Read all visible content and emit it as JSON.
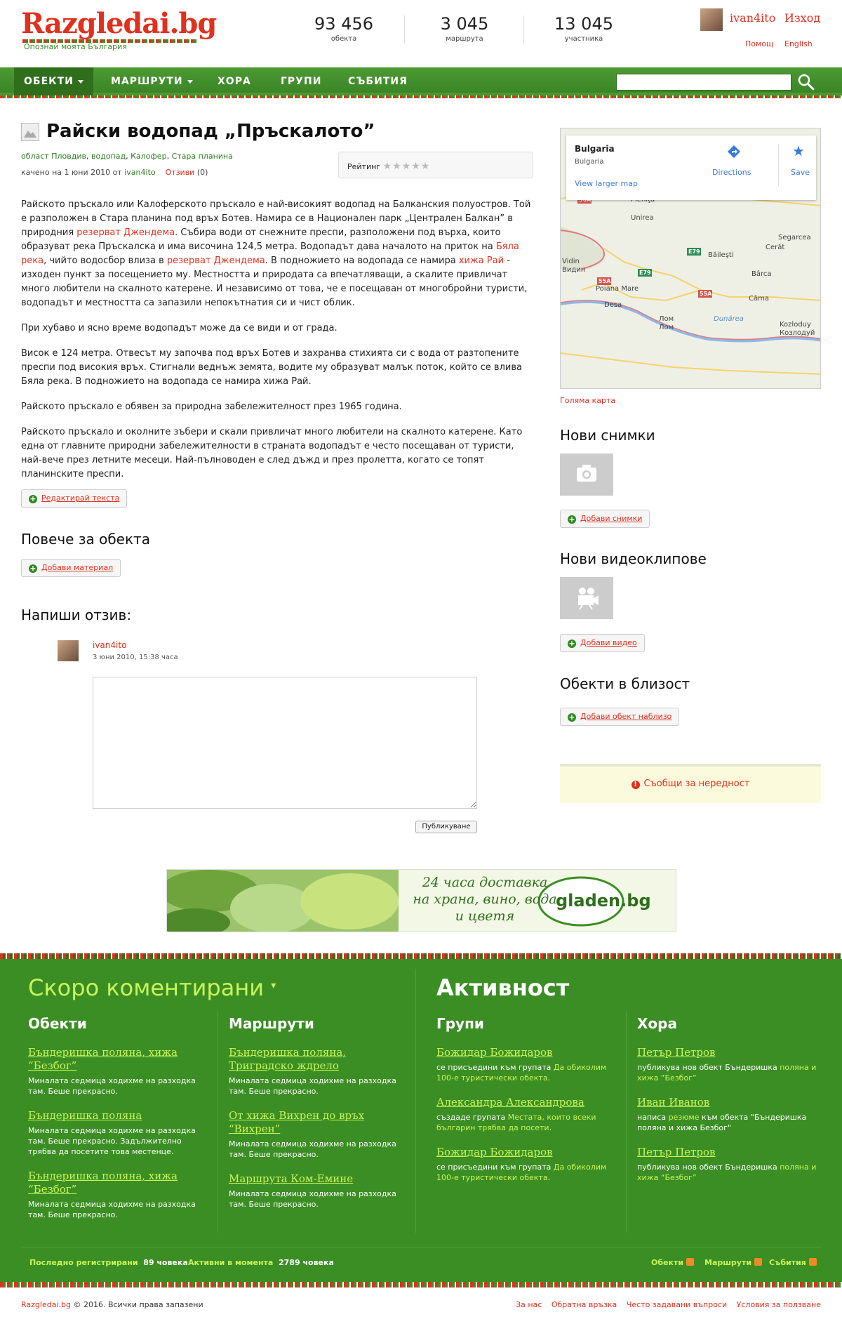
{
  "header": {
    "logo": "Razgledai.bg",
    "tagline": "Опознай моята България",
    "stats": [
      {
        "num": "93 456",
        "label": "обекта"
      },
      {
        "num": "3 045",
        "label": "маршрута"
      },
      {
        "num": "13 045",
        "label": "участника"
      }
    ],
    "username": "ivan4ito",
    "logout": "Изход",
    "help": "Помощ",
    "english": "English"
  },
  "nav": {
    "items": [
      "ОБЕКТИ",
      "МАРШРУТИ",
      "ХОРА",
      "ГРУПИ",
      "СЪБИТИЯ"
    ],
    "search_placeholder": ""
  },
  "object": {
    "title": "Райски водопад „Пръскалото”",
    "crumbs": [
      "област Пловдив",
      "водопад",
      "Калофер",
      "Стара планина"
    ],
    "uploaded_prefix": "качено на 1 юни 2010 от",
    "uploaded_by": "ivan4ito",
    "reviews_link": "Отзиви",
    "reviews_count": "(0)",
    "rating_label": "Рейтинг",
    "stars": "★★★★★",
    "edit_text": "Редактирай текста"
  },
  "body": {
    "p1a": "Райското пръскало или Калоферското пръскало е най-високият водопад на Балканския полуостров. Той е разположен в Стара планина под връх Ботев. Намира се в Национален парк „Централен Балкан” в природния ",
    "p1_link1": "резерват Джендема",
    "p1b": ". Събира води от снежните преспи, разположени под върха, които образуват река Пръскалска и има височина 124,5 метра. Водопадът дава началото на приток на ",
    "p1_link2": "Бяла река",
    "p1c": ", чийто водосбор влиза в ",
    "p1_link3": "резерват Джендема",
    "p1d": ". В подножието на водопада се намира ",
    "p1_link4": "хижа Рай",
    "p1e": " - изходен пункт за посещението му. Местността и природата са впечатляващи, а скалите привличат много любители на скалното катерене. И независимо от това, че е посещаван от многобройни туристи, водопадът и местността са запазили непокътнатия си и чист облик.",
    "p2": "При хубаво и ясно време водопадът може да се види и от града.",
    "p3": "Висок е 124 метра. Отвесът му започва под връх Ботев и захранва стихията си с вода от разтопените преспи под високия връх. Стигнали веднъж земята, водите му образуват малък поток, който се влива Бяла река. В подножието на водопада се намира хижа Рай.",
    "p4": "Райското пръскало е обявен за природна забележителност през 1965 година.",
    "p5": "Райското пръскало и околните зъбери и скали привличат много любители на скалното катерене. Като една от главните природни забележителности в страната водопадът е често посещаван от туристи, най-вече през летните месеци. Най-пълноводен е след дъжд и през пролетта, когато се топят планинските преспи."
  },
  "more": {
    "title": "Повече за обекта",
    "add_material": "Добави материал"
  },
  "review": {
    "title": "Напиши отзив:",
    "user": "ivan4ito",
    "date": "3 юни 2010, 15:38 часа",
    "publish": "Публикуване"
  },
  "sidebar": {
    "map": {
      "place": "Bulgaria",
      "subplace": "Bulgaria",
      "larger": "View larger map",
      "directions": "Directions",
      "save": "Save",
      "labels": [
        "Pleniţa",
        "Unirea",
        "Segarcea",
        "Cerăt",
        "Băileşti",
        "Vidin",
        "Видин",
        "Bârca",
        "Poiana Mare",
        "Câma",
        "Desa",
        "Лом",
        "Лом",
        "Kozloduy",
        "Козлодуй",
        "Dunărea"
      ],
      "roads": [
        "56A",
        "E79",
        "E79",
        "55A",
        "55A"
      ]
    },
    "big_map": "Голяма карта",
    "new_photos": "Нови снимки",
    "add_photos": "Добави снимки",
    "new_videos": "Нови видеоклипове",
    "add_video": "Добави видео",
    "nearby": "Обекти в близост",
    "add_nearby": "Добави обект наблизо",
    "report": "Съобщи за нередност"
  },
  "banner": {
    "line1": "24 часа доставка",
    "line2": "на храна, вино, вода",
    "line3": "и цветя",
    "brand": "gladen.bg"
  },
  "footer": {
    "recent_title": "Скоро коментирани",
    "activity_title": "Активност",
    "objects_title": "Обекти",
    "routes_title": "Маршрути",
    "groups_title": "Групи",
    "people_title": "Хора",
    "objects": [
      {
        "link": "Бъндеришка поляна, хижа “Безбог”",
        "desc": "Миналата седмица ходихме на разходка там. Беше прекрасно."
      },
      {
        "link": "Бъндеришка поляна",
        "desc": "Миналата седмица ходихме на разходка там. Беше прекрасно. Задължително трябва да посетите това местенце."
      },
      {
        "link": "Бъндеришка поляна, хижа “Безбог”",
        "desc": "Миналата седмица ходихме на разходка там. Беше прекрасно."
      }
    ],
    "routes": [
      {
        "link": "Бъндеришка поляна, Тригрaдско ждрело",
        "desc": "Миналата седмица ходихме на разходка там. Беше прекрасно."
      },
      {
        "link": "От хижа Вихрен до връх “Вихрен”",
        "desc": "Миналата седмица ходихме на разходка там. Беше прекрасно."
      },
      {
        "link": "Маршрута Ком-Емине",
        "desc": "Миналата седмица ходихме на разходка там. Беше прекрасно."
      }
    ],
    "groups": [
      {
        "link": "Божидар Божидаров",
        "pre": "се присъедини към групата ",
        "target": "Да обиколим 100-е туристически обекта",
        "post": "."
      },
      {
        "link": "Александра Александрова",
        "pre": "създаде групата ",
        "target": "Местата, които всеки българин трябва да посети",
        "post": "."
      },
      {
        "link": "Божидар Божидаров",
        "pre": "се присъедини към групата ",
        "target": "Да обиколим 100-е туристически обекта",
        "post": "."
      }
    ],
    "people": [
      {
        "link": "Петър Петров",
        "pre": "публикува нов обект Бъндеришка ",
        "target": "поляна и хижа “Безбог”",
        "post": ""
      },
      {
        "link": "Иван Иванов",
        "pre": "написа ",
        "target": "резюме",
        "post": " към обекта \"Бъндеришка поляна и хижа Безбог\""
      },
      {
        "link": "Петър Петров",
        "pre": "публикува нов обект Бъндеришка ",
        "target": "поляна и хижа “Безбог”",
        "post": ""
      }
    ],
    "last_registered_label": "Последно регистрирани",
    "last_registered_value": "89 човека",
    "active_label": "Активни в момента",
    "active_value": "2789 човека",
    "rss": [
      "Обекти",
      "Маршрути",
      "Събития"
    ],
    "copyright_link": "Razgledai.bg",
    "copyright_text": " © 2016. Всички права запазени",
    "links": [
      "За нас",
      "Обратна връзка",
      "Често задавани въпроси",
      "Условия за ползване"
    ]
  }
}
